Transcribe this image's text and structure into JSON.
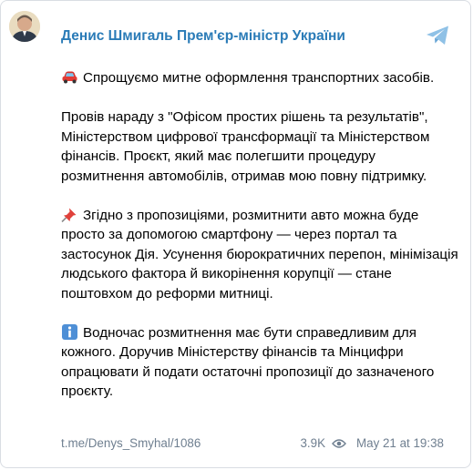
{
  "channel": {
    "name": "Денис Шмигаль Прем'єр-міністр України",
    "accent_color": "#2a7bb7"
  },
  "message": {
    "paragraphs": [
      {
        "icon": "car-emoji",
        "text": "Спрощуємо митне оформлення транспортних засобів."
      },
      {
        "icon": "",
        "text": "Провів нараду з \"Офісом простих рішень та результатів\", Міністерством цифрової трансформації та Міністерством фінансів. Проєкт, який має полегшити процедуру розмитнення автомобілів, отримав мою повну підтримку."
      },
      {
        "icon": "pushpin-emoji",
        "text": "Згідно з пропозиціями, розмитнити авто можна буде просто за допомогою смартфону — через портал та застосунок Дія. Усунення бюрократичних перепон, мінімізація людського фактора й викорінення корупції — стане поштовхом до реформи митниці."
      },
      {
        "icon": "info-emoji",
        "text": "Водночас розмитнення має бути справедливим для кожного. Доручив Міністерству фінансів та Мінцифри опрацювати й подати остаточні пропозиції до зазначеного проєкту."
      }
    ]
  },
  "footer": {
    "link": "t.me/Denys_Smyhal/1086",
    "views": "3.9K",
    "date": "May 21 at 19:38",
    "meta_color": "#6f7f90"
  },
  "icons": {
    "share": "telegram-share-icon",
    "views": "eye-icon"
  }
}
